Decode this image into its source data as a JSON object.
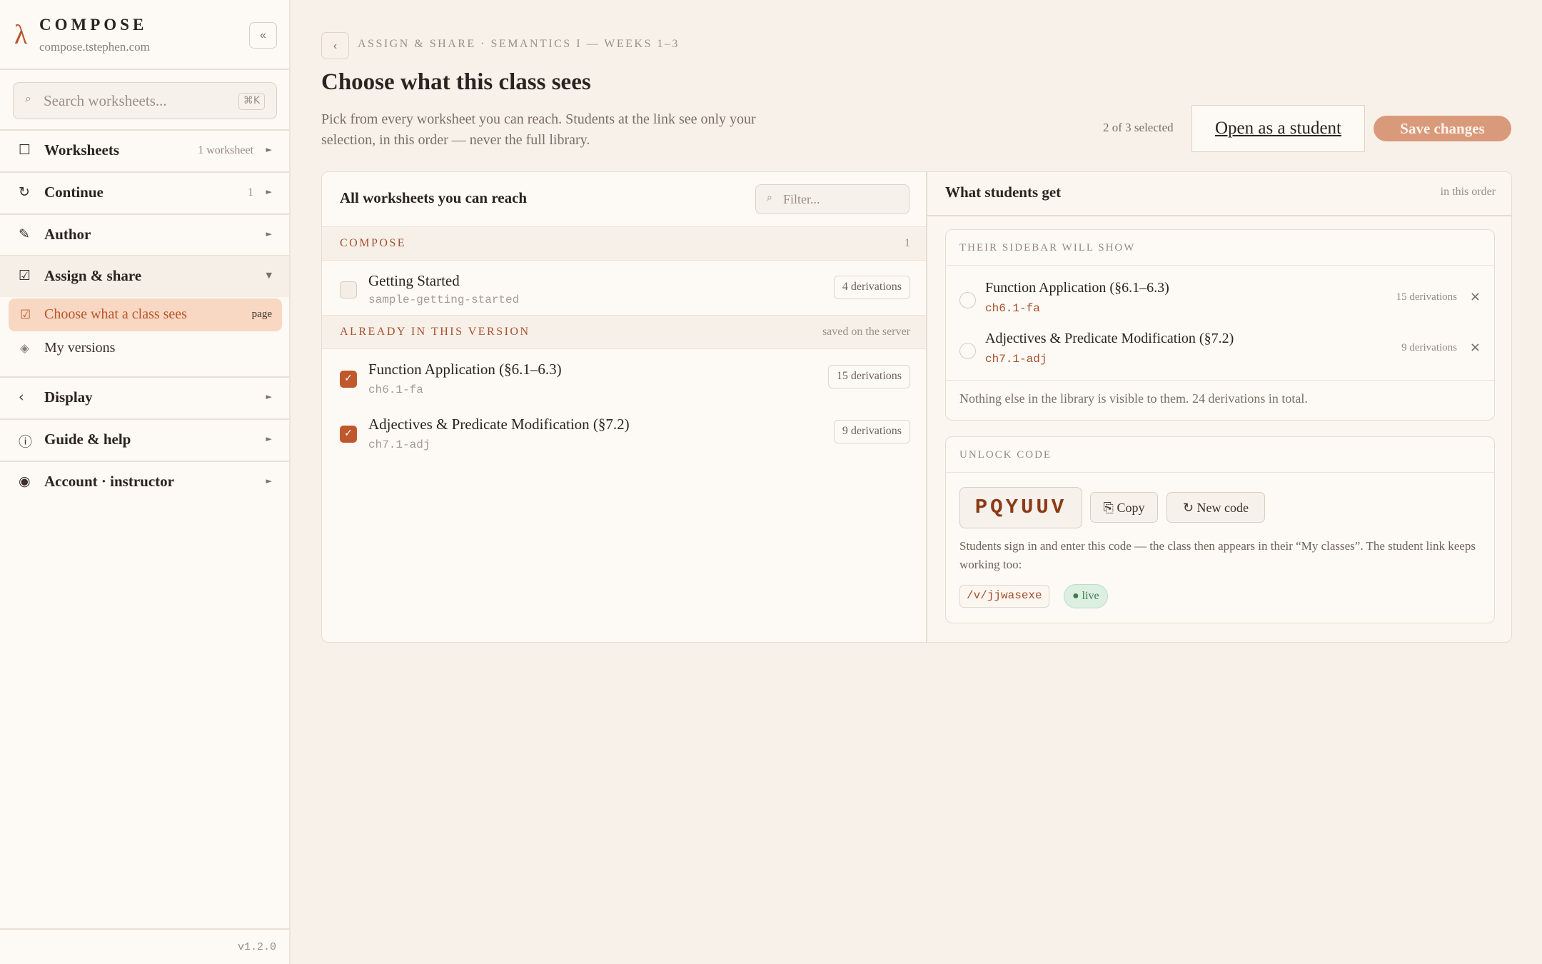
{
  "app": {
    "logo_glyph": "λ",
    "name": "COMPOSE",
    "url": "compose.tstephen.com",
    "collapse_label": "«",
    "version": "v1.2.0"
  },
  "search": {
    "icon": "search-icon",
    "placeholder": "Search worksheets...",
    "shortcut": "⌘K"
  },
  "sidebar": {
    "worksheets": {
      "icon": "☐",
      "label": "Worksheets",
      "meta": "1 worksheet",
      "chevron": "►"
    },
    "continue": {
      "icon": "↻",
      "label": "Continue",
      "meta": "1",
      "chevron": "►"
    },
    "author": {
      "icon": "✎",
      "label": "Author",
      "chevron": "►"
    },
    "assign": {
      "icon": "☑",
      "label": "Assign & share",
      "chevron": "▼",
      "children": [
        {
          "icon": "☑",
          "label": "Choose what a class sees",
          "tag": "page"
        },
        {
          "icon": "◈",
          "label": "My versions"
        }
      ]
    },
    "display": {
      "icon": "‹",
      "label": "Display",
      "chevron": "►"
    },
    "guide": {
      "icon": "ⓘ",
      "label": "Guide & help",
      "chevron": "►"
    },
    "account": {
      "icon": "◉",
      "label": "Account · instructor",
      "chevron": "►"
    }
  },
  "header": {
    "back_label": "‹",
    "breadcrumb": "ASSIGN & SHARE · SEMANTICS I — WEEKS 1–3",
    "title": "Choose what this class sees",
    "description": "Pick from every worksheet you can reach. Students at the link see only your selection, in this order — never the full library.",
    "selected_count": "2 of 3 selected",
    "open_student_label": "Open as a student",
    "save_label": "Save changes"
  },
  "library": {
    "title": "All worksheets you can reach",
    "filter_icon": "search-icon",
    "filter_placeholder": "Filter...",
    "groups": [
      {
        "title": "COMPOSE",
        "meta": "1",
        "items": [
          {
            "name": "Getting Started",
            "slug": "sample-getting-started",
            "derivations": "4 derivations",
            "checked": false
          }
        ]
      },
      {
        "title": "ALREADY IN THIS VERSION",
        "meta": "saved on the server",
        "items": [
          {
            "name": "Function Application (§6.1–6.3)",
            "slug": "ch6.1-fa",
            "derivations": "15 derivations",
            "checked": true
          },
          {
            "name": "Adjectives & Predicate Modification (§7.2)",
            "slug": "ch7.1-adj",
            "derivations": "9 derivations",
            "checked": true
          }
        ]
      }
    ],
    "check_glyph": "✓"
  },
  "students": {
    "title": "What students get",
    "order_note": "in this order",
    "sidebar_card": {
      "header": "THEIR SIDEBAR WILL SHOW",
      "items": [
        {
          "name": "Function Application (§6.1–6.3)",
          "slug": "ch6.1-fa",
          "derivations": "15 derivations"
        },
        {
          "name": "Adjectives & Predicate Modification (§7.2)",
          "slug": "ch7.1-adj",
          "derivations": "9 derivations"
        }
      ],
      "remove_glyph": "×",
      "footer": "Nothing else in the library is visible to them. 24 derivations in total."
    },
    "unlock_card": {
      "header": "UNLOCK CODE",
      "code": "PQYUUV",
      "copy_label": "⎘ Copy",
      "new_code_label": "↻ New code",
      "help": "Students sign in and enter this code — the class then appears in their “My classes”. The student link keeps working too:",
      "link": "/v/jjwasexe",
      "status": "● live"
    }
  },
  "colors": {
    "accent": "#c0582e",
    "accent_soft": "#f8d8c2",
    "save_button": "#d89a7a",
    "live_green": "#dcefe0",
    "background": "#f8f1ea"
  }
}
